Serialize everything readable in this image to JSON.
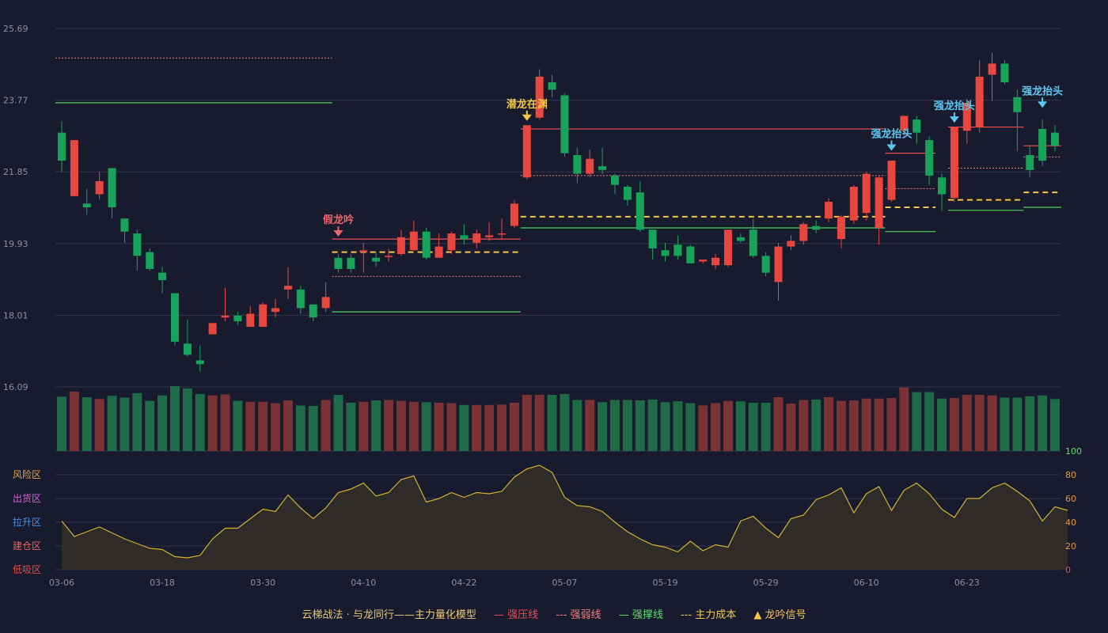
{
  "chart_data": {
    "type": "candlestick",
    "price_axis": {
      "ticks": [
        "25.69",
        "23.77",
        "21.85",
        "19.93",
        "18.01",
        "16.09"
      ],
      "ylim": [
        16.09,
        25.69
      ]
    },
    "x_ticks": [
      {
        "index": 0,
        "label": "03-06"
      },
      {
        "index": 8,
        "label": "03-18"
      },
      {
        "index": 16,
        "label": "03-30"
      },
      {
        "index": 24,
        "label": "04-10"
      },
      {
        "index": 32,
        "label": "04-22"
      },
      {
        "index": 40,
        "label": "05-07"
      },
      {
        "index": 48,
        "label": "05-19"
      },
      {
        "index": 56,
        "label": "05-29"
      },
      {
        "index": 64,
        "label": "06-10"
      },
      {
        "index": 72,
        "label": "06-23"
      }
    ],
    "candles": [
      [
        22.9,
        22.15,
        23.2,
        21.85
      ],
      [
        21.2,
        22.7,
        22.7,
        21.2
      ],
      [
        21.0,
        20.9,
        21.4,
        20.7
      ],
      [
        21.25,
        21.6,
        21.85,
        21.1
      ],
      [
        21.95,
        20.9,
        21.95,
        20.6
      ],
      [
        20.6,
        20.25,
        20.6,
        19.95
      ],
      [
        20.2,
        19.6,
        20.3,
        19.2
      ],
      [
        19.7,
        19.25,
        19.8,
        19.2
      ],
      [
        19.15,
        18.95,
        19.3,
        18.6
      ],
      [
        18.6,
        17.3,
        18.6,
        17.2
      ],
      [
        17.25,
        16.95,
        17.9,
        16.9
      ],
      [
        16.8,
        16.7,
        17.2,
        16.5
      ],
      [
        17.5,
        17.8,
        17.8,
        17.5
      ],
      [
        17.95,
        18.0,
        18.75,
        17.85
      ],
      [
        18.0,
        17.85,
        18.1,
        17.75
      ],
      [
        17.7,
        18.05,
        18.25,
        17.7
      ],
      [
        17.7,
        18.3,
        18.35,
        17.7
      ],
      [
        18.1,
        18.2,
        18.45,
        17.95
      ],
      [
        18.7,
        18.8,
        19.3,
        18.45
      ],
      [
        18.7,
        18.2,
        18.8,
        18.05
      ],
      [
        18.3,
        17.95,
        18.3,
        17.85
      ],
      [
        18.2,
        18.5,
        18.9,
        18.1
      ],
      [
        19.55,
        19.25,
        19.65,
        19.15
      ],
      [
        19.55,
        19.25,
        19.65,
        19.15
      ],
      [
        19.7,
        19.75,
        19.95,
        19.15
      ],
      [
        19.55,
        19.45,
        19.7,
        19.3
      ],
      [
        19.6,
        19.6,
        19.8,
        19.45
      ],
      [
        19.65,
        20.1,
        20.3,
        19.6
      ],
      [
        19.75,
        20.25,
        20.55,
        19.75
      ],
      [
        20.25,
        19.55,
        20.35,
        19.5
      ],
      [
        19.55,
        19.85,
        20.2,
        19.55
      ],
      [
        19.75,
        20.2,
        20.25,
        19.65
      ],
      [
        20.15,
        20.05,
        20.45,
        19.9
      ],
      [
        19.95,
        20.2,
        20.3,
        19.8
      ],
      [
        20.1,
        20.15,
        20.5,
        20.0
      ],
      [
        20.2,
        20.2,
        20.6,
        20.05
      ],
      [
        20.4,
        21.0,
        21.1,
        20.35
      ],
      [
        21.7,
        23.1,
        23.1,
        21.65
      ],
      [
        23.3,
        24.4,
        24.6,
        23.25
      ],
      [
        24.25,
        24.05,
        24.45,
        23.85
      ],
      [
        23.9,
        22.35,
        23.95,
        22.25
      ],
      [
        22.3,
        21.8,
        22.5,
        21.55
      ],
      [
        21.8,
        22.2,
        22.45,
        21.7
      ],
      [
        22.0,
        21.9,
        22.5,
        21.8
      ],
      [
        21.75,
        21.5,
        21.8,
        21.25
      ],
      [
        21.45,
        21.1,
        21.5,
        20.95
      ],
      [
        21.3,
        20.3,
        21.6,
        20.25
      ],
      [
        20.3,
        19.8,
        20.3,
        19.5
      ],
      [
        19.75,
        19.6,
        19.95,
        19.45
      ],
      [
        19.9,
        19.6,
        20.15,
        19.5
      ],
      [
        19.85,
        19.4,
        19.9,
        19.4
      ],
      [
        19.45,
        19.5,
        19.5,
        19.4
      ],
      [
        19.35,
        19.55,
        19.65,
        19.25
      ],
      [
        19.35,
        20.3,
        20.3,
        19.3
      ],
      [
        20.1,
        20.0,
        20.2,
        19.95
      ],
      [
        20.3,
        19.6,
        20.6,
        19.55
      ],
      [
        19.6,
        19.15,
        19.7,
        19.05
      ],
      [
        18.9,
        19.85,
        19.95,
        18.4
      ],
      [
        19.85,
        20.0,
        20.15,
        19.75
      ],
      [
        20.0,
        20.45,
        20.5,
        19.9
      ],
      [
        20.4,
        20.3,
        20.55,
        20.2
      ],
      [
        20.6,
        21.05,
        21.15,
        20.5
      ],
      [
        20.05,
        20.65,
        20.7,
        19.8
      ],
      [
        20.55,
        21.45,
        21.5,
        20.45
      ],
      [
        20.75,
        21.8,
        21.85,
        20.55
      ],
      [
        20.35,
        21.7,
        21.75,
        19.9
      ],
      [
        21.1,
        22.15,
        22.15,
        21.05
      ],
      [
        22.95,
        23.35,
        23.35,
        22.8
      ],
      [
        23.25,
        22.9,
        23.35,
        22.6
      ],
      [
        22.7,
        21.75,
        22.8,
        21.5
      ],
      [
        21.7,
        21.25,
        21.8,
        20.8
      ],
      [
        21.15,
        23.05,
        23.05,
        21.05
      ],
      [
        22.95,
        23.7,
        23.8,
        22.6
      ],
      [
        23.05,
        24.4,
        24.85,
        22.9
      ],
      [
        24.45,
        24.75,
        25.05,
        23.75
      ],
      [
        24.75,
        24.25,
        24.85,
        24.2
      ],
      [
        23.85,
        23.45,
        24.05,
        22.4
      ],
      [
        22.3,
        21.9,
        22.55,
        21.7
      ],
      [
        23.0,
        22.15,
        23.25,
        22.0
      ],
      [
        22.9,
        22.55,
        23.1,
        22.4
      ]
    ],
    "volume": [
      11.8,
      12.9,
      11.7,
      11.3,
      12.0,
      11.6,
      12.6,
      10.9,
      12.1,
      14.1,
      13.6,
      12.4,
      12.1,
      12.3,
      10.9,
      10.7,
      10.7,
      10.4,
      11.0,
      9.9,
      9.8,
      11.1,
      12.2,
      10.5,
      10.7,
      11.0,
      11.1,
      10.9,
      10.7,
      10.6,
      10.5,
      10.4,
      10.0,
      10.0,
      10.0,
      10.1,
      10.5,
      12.2,
      12.2,
      12.2,
      12.4,
      11.1,
      11.1,
      10.6,
      11.1,
      11.1,
      11.0,
      11.2,
      10.6,
      10.8,
      10.4,
      9.9,
      10.4,
      10.9,
      10.8,
      10.5,
      10.5,
      11.7,
      10.3,
      11.1,
      11.2,
      11.7,
      10.9,
      11.0,
      11.4,
      11.4,
      11.5,
      13.8,
      12.8,
      12.8,
      11.4,
      11.5,
      12.2,
      12.2,
      12.1,
      11.6,
      11.6,
      11.9,
      12.1,
      11.3
    ],
    "oscillator": {
      "right_ticks": [
        "100",
        "80",
        "60",
        "40",
        "20",
        "0"
      ],
      "zones": [
        "风险区",
        "出货区",
        "拉升区",
        "建仓区",
        "低吸区"
      ],
      "values": [
        41,
        28,
        32,
        36,
        31,
        26,
        22,
        18,
        17,
        11,
        10,
        12,
        26,
        35,
        35,
        43,
        51,
        49,
        63,
        52,
        43,
        52,
        65,
        68,
        73,
        62,
        65,
        76,
        79,
        57,
        60,
        65,
        61,
        65,
        64,
        66,
        78,
        85,
        88,
        82,
        61,
        54,
        53,
        49,
        40,
        32,
        26,
        21,
        19,
        15,
        24,
        16,
        21,
        19,
        41,
        45,
        35,
        27,
        43,
        46,
        59,
        63,
        69,
        48,
        64,
        70,
        50,
        67,
        73,
        64,
        51,
        44,
        60,
        60,
        69,
        73,
        66,
        58,
        41,
        53,
        50
      ],
      "yrange": [
        0,
        100
      ]
    },
    "lines": {
      "strong_pressure": [
        {
          "from": 22,
          "to": 36,
          "value": 20.05
        },
        {
          "from": 37,
          "to": 65,
          "value": 23.0
        },
        {
          "from": 66,
          "to": 69,
          "value": 22.35
        },
        {
          "from": 71,
          "to": 76,
          "value": 23.05
        },
        {
          "from": 77,
          "to": 79,
          "value": 22.55
        }
      ],
      "strong_weak": [
        {
          "from": 0,
          "to": 21,
          "value": 24.9
        },
        {
          "from": 22,
          "to": 36,
          "value": 19.05
        },
        {
          "from": 37,
          "to": 65,
          "value": 21.75
        },
        {
          "from": 66,
          "to": 69,
          "value": 21.4
        },
        {
          "from": 71,
          "to": 76,
          "value": 21.95
        },
        {
          "from": 77,
          "to": 79,
          "value": 22.25
        }
      ],
      "strong_support": [
        {
          "from": 0,
          "to": 21,
          "value": 23.7
        },
        {
          "from": 22,
          "to": 36,
          "value": 18.1
        },
        {
          "from": 37,
          "to": 65,
          "value": 20.35
        },
        {
          "from": 66,
          "to": 69,
          "value": 20.25
        },
        {
          "from": 71,
          "to": 76,
          "value": 20.82
        },
        {
          "from": 77,
          "to": 79,
          "value": 20.9
        }
      ],
      "main_cost": [
        {
          "from": 22,
          "to": 36,
          "value": 19.7
        },
        {
          "from": 37,
          "to": 65,
          "value": 20.65
        },
        {
          "from": 66,
          "to": 69,
          "value": 20.9
        },
        {
          "from": 71,
          "to": 76,
          "value": 21.1
        },
        {
          "from": 77,
          "to": 79,
          "value": 21.3
        }
      ]
    },
    "signals": [
      {
        "index": 22,
        "label": "假龙吟",
        "color": "#e8656e",
        "arrow_at": 20.2
      },
      {
        "index": 37,
        "label": "潜龙在渊",
        "color": "#f5c84a",
        "arrow_at": 23.3
      },
      {
        "index": 66,
        "label": "强龙抬头",
        "color": "#5cc8f0",
        "arrow_at": 22.5
      },
      {
        "index": 71,
        "label": "强龙抬头",
        "color": "#5cc8f0",
        "arrow_at": 23.25
      },
      {
        "index": 78,
        "label": "强龙抬头",
        "color": "#5cc8f0",
        "arrow_at": 23.65
      }
    ]
  },
  "legend": {
    "title": "云梯战法 · 与龙同行——主力量化模型",
    "items": [
      {
        "label": "强压线",
        "symbol": "—",
        "color": "#ef4f4f"
      },
      {
        "label": "强弱线",
        "symbol": "---",
        "color": "#f08080"
      },
      {
        "label": "强撑线",
        "symbol": "—",
        "color": "#5fe06a"
      },
      {
        "label": "主力成本",
        "symbol": "---",
        "color": "#f5c84a"
      },
      {
        "label": "龙吟信号",
        "symbol": "▲",
        "color": "#f5c84a"
      }
    ]
  },
  "colors": {
    "background": "#181a2e",
    "up": "#e7473e",
    "down": "#18a35b",
    "grid": "#34374c",
    "oscillator_line": "#d4b22e",
    "zone_risk": "#e8a33a",
    "zone_ship": "#d460d8",
    "zone_pull": "#4a90e8",
    "zone_build": "#e8655e",
    "zone_low": "#e84a4a",
    "osc_tick_top": "#5fe06a",
    "osc_tick": "#e89a3a",
    "osc_tick_bottom": "#e84a4a"
  }
}
